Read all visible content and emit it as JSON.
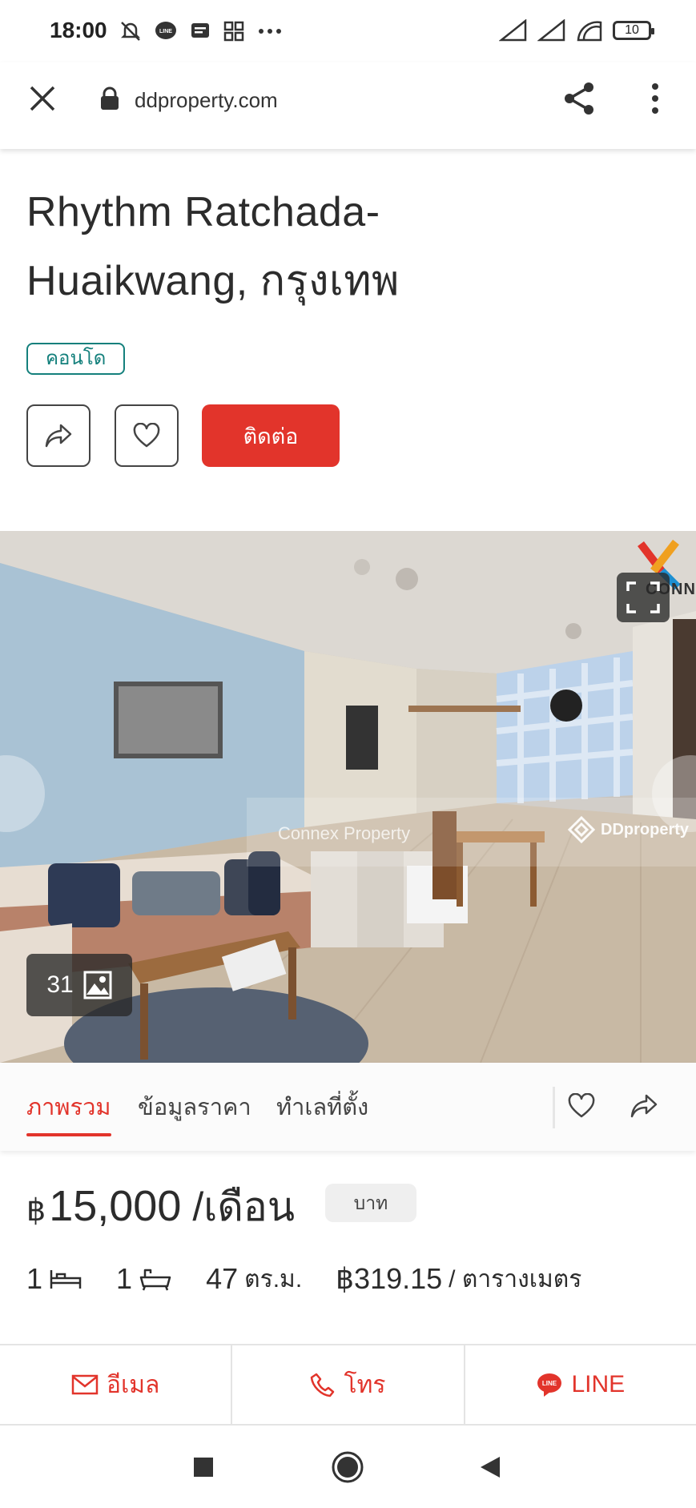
{
  "status_bar": {
    "time": "18:00",
    "battery": "10",
    "left_icons": [
      "mute-icon",
      "line-icon",
      "message-icon",
      "apps-icon",
      "more-dots-icon"
    ],
    "right_icons": [
      "signal-icon",
      "signal-icon",
      "wifi-icon",
      "battery-icon"
    ]
  },
  "browser": {
    "url": "ddproperty.com",
    "icons": [
      "close-icon",
      "lock-icon",
      "share-icon",
      "more-vertical-icon"
    ]
  },
  "listing": {
    "title_line1": "Rhythm Ratchada-",
    "title_line2_name": "Huaikwang,",
    "title_line2_city": " กรุงเทพ",
    "property_type": "คอนโด",
    "contact_label": "ติดต่อ"
  },
  "photo": {
    "count": "31",
    "watermark_agent": "Connex Property",
    "watermark_site": "DDproperty",
    "brand_logo": "CONNEX"
  },
  "tabs": [
    {
      "label": "ภาพรวม",
      "active": true
    },
    {
      "label": "ข้อมูลราคา",
      "active": false
    },
    {
      "label": "ทำเลที่ตั้ง",
      "active": false
    }
  ],
  "price": {
    "currency": "฿",
    "amount": "15,000",
    "unit": "/เดือน",
    "chip": "บาท"
  },
  "specs": {
    "bedrooms": "1",
    "bathrooms": "1",
    "area": "47",
    "area_unit": "ตร.ม.",
    "price_per_sqm": "฿319.15",
    "price_per_sqm_unit": "/ ตารางเมตร"
  },
  "contact_bar": {
    "email": "อีเมล",
    "call": "โทร",
    "line": "LINE"
  },
  "colors": {
    "accent": "#e2342b",
    "badge": "#14807c"
  }
}
